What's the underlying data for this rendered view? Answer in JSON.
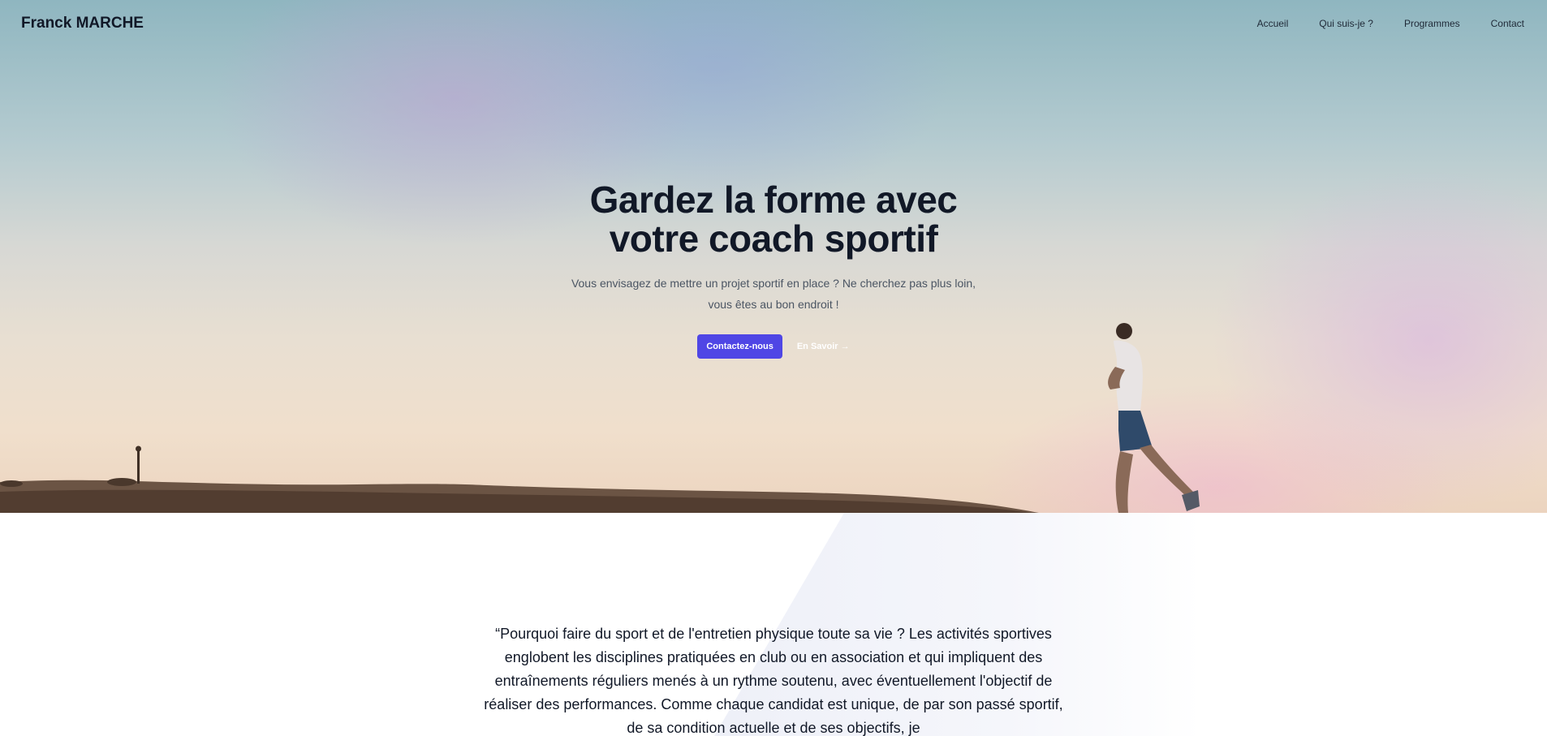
{
  "nav": {
    "brand": "Franck MARCHE",
    "links": [
      {
        "label": "Accueil"
      },
      {
        "label": "Qui suis-je ?"
      },
      {
        "label": "Programmes"
      },
      {
        "label": "Contact"
      }
    ]
  },
  "hero": {
    "title_line1": "Gardez la forme avec",
    "title_line2": "votre coach sportif",
    "subtitle_line1": "Vous envisagez de mettre un projet sportif en place ? Ne cherchez pas plus loin,",
    "subtitle_line2": "vous êtes au bon endroit !",
    "primary_button": "Contactez-nous",
    "secondary_link": "En Savoir →"
  },
  "quote": {
    "text": "“Pourquoi faire du sport et de l'entretien physique toute sa vie ? Les activités sportives englobent les disciplines pratiquées en club ou en association et qui impliquent des entraînements réguliers menés à un rythme soutenu, avec éventuellement l'objectif de réaliser des performances. Comme chaque candidat est unique, de par son passé sportif, de sa condition actuelle et de ses objectifs, je"
  },
  "colors": {
    "accent": "#4f46e5",
    "text_dark": "#111827",
    "text_muted": "#4b5563"
  }
}
